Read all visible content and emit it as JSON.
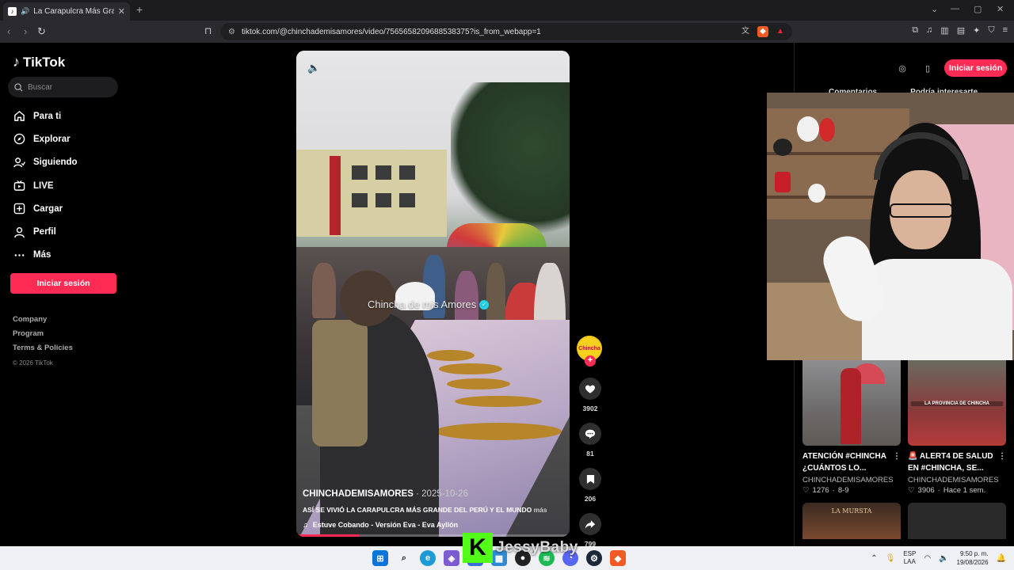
{
  "browser": {
    "tab_title": "La Carapulcra Más Grande de",
    "url": "tiktok.com/@chinchademisamores/video/7565658209688538375?is_from_webapp=1"
  },
  "sidebar": {
    "logo": "TikTok",
    "search_placeholder": "Buscar",
    "items": [
      {
        "label": "Para ti",
        "icon": "home-icon"
      },
      {
        "label": "Explorar",
        "icon": "compass-icon"
      },
      {
        "label": "Siguiendo",
        "icon": "following-icon"
      },
      {
        "label": "LIVE",
        "icon": "live-icon"
      },
      {
        "label": "Cargar",
        "icon": "upload-icon"
      },
      {
        "label": "Perfil",
        "icon": "profile-icon"
      },
      {
        "label": "Más",
        "icon": "more-icon"
      }
    ],
    "login": "Iniciar sesión",
    "footer": [
      "Company",
      "Program",
      "Terms & Policies"
    ],
    "copyright": "© 2026 TikTok"
  },
  "video": {
    "overlay_text": "Chincha de mis Amores",
    "author": "CHINCHADEMISAMORES",
    "date": "· 2025-10-26",
    "description": "ASÍ SE VIVIÓ LA CARAPULCRA MÁS GRANDE DEL PERÚ Y EL MUNDO",
    "more": "más",
    "music": "Estuve Cobando - Versión Eva - Eva Ayllón",
    "progress": 0.23
  },
  "actions": {
    "avatar_text": "Chincha",
    "likes": "3902",
    "comments": "81",
    "saves": "206",
    "shares": "799"
  },
  "right": {
    "login": "Iniciar sesión",
    "tabs": [
      "Comentarios",
      "Podría interesarte"
    ]
  },
  "cards": [
    {
      "title": "ATENCIÓN #CHINCHA ¿CUÁNTOS LO...",
      "author": "CHINCHADEMISAMORES",
      "likes": "1276",
      "time": "8-9"
    },
    {
      "title": "🚨 ALERT4 DE SALUD EN #CHINCHA, SE...",
      "author": "CHINCHADEMISAMORES",
      "likes": "3906",
      "time": "Hace 1 sem.",
      "caption": "LA PROVINCIA DE CHINCHA"
    }
  ],
  "card3_text": "LA MURSTA",
  "taskbar": {
    "lang_top": "ESP",
    "lang_bottom": "LAA",
    "time": "9:50 p. m.",
    "date": "19/08/2026"
  },
  "stream": {
    "kick_letter": "K",
    "name": "JessyBaby"
  },
  "colors": {
    "accent": "#fe2c55",
    "kick": "#53fc18"
  }
}
